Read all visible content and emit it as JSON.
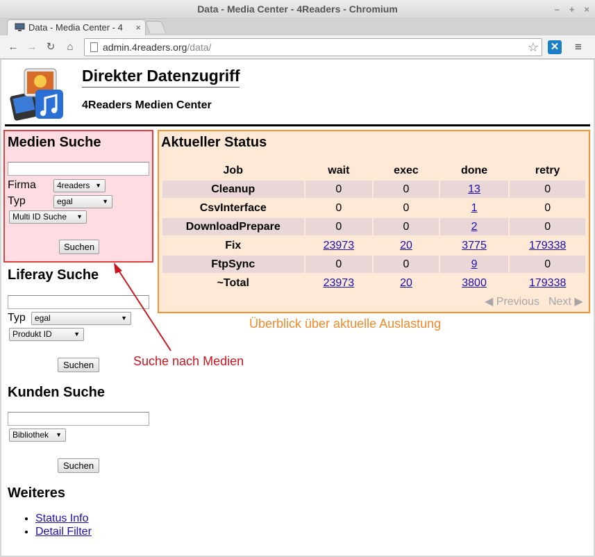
{
  "window": {
    "title": "Data - Media Center - 4Readers - Chromium"
  },
  "tab": {
    "label": "Data - Media Center - 4"
  },
  "address": {
    "host": "admin.4readers.org",
    "path": "/data/"
  },
  "header": {
    "title": "Direkter Datenzugriff",
    "subtitle": "4Readers Medien Center"
  },
  "medien": {
    "title": "Medien Suche",
    "firma_label": "Firma",
    "firma_value": "4readers",
    "typ_label": "Typ",
    "typ_value": "egal",
    "mode_value": "Multi ID Suche",
    "button": "Suchen"
  },
  "liferay": {
    "title": "Liferay Suche",
    "typ_label": "Typ",
    "typ_value": "egal",
    "mode_value": "Produkt ID",
    "button": "Suchen"
  },
  "kunden": {
    "title": "Kunden Suche",
    "mode_value": "Bibliothek",
    "button": "Suchen"
  },
  "weiteres": {
    "title": "Weiteres",
    "links": [
      "Status Info",
      "Detail Filter"
    ]
  },
  "status": {
    "title": "Aktueller Status",
    "columns": [
      "Job",
      "wait",
      "exec",
      "done",
      "retry"
    ],
    "rows": [
      [
        "Cleanup",
        "0",
        "0",
        "13",
        "0"
      ],
      [
        "CsvInterface",
        "0",
        "0",
        "1",
        "0"
      ],
      [
        "DownloadPrepare",
        "0",
        "0",
        "2",
        "0"
      ],
      [
        "Fix",
        "23973",
        "20",
        "3775",
        "179338"
      ],
      [
        "FtpSync",
        "0",
        "0",
        "9",
        "0"
      ],
      [
        "~Total",
        "23973",
        "20",
        "3800",
        "179338"
      ]
    ],
    "pager_prev": "Previous",
    "pager_next": "Next"
  },
  "annotations": {
    "medien_caption": "Suche nach Medien",
    "status_caption": "Überblick über aktuelle Auslastung"
  },
  "colors": {
    "pink_box": "#fddde2",
    "pink_border": "#e0403f",
    "orange_box": "#fde9d6",
    "orange_border": "#f59331",
    "link": "#1a0dab"
  }
}
